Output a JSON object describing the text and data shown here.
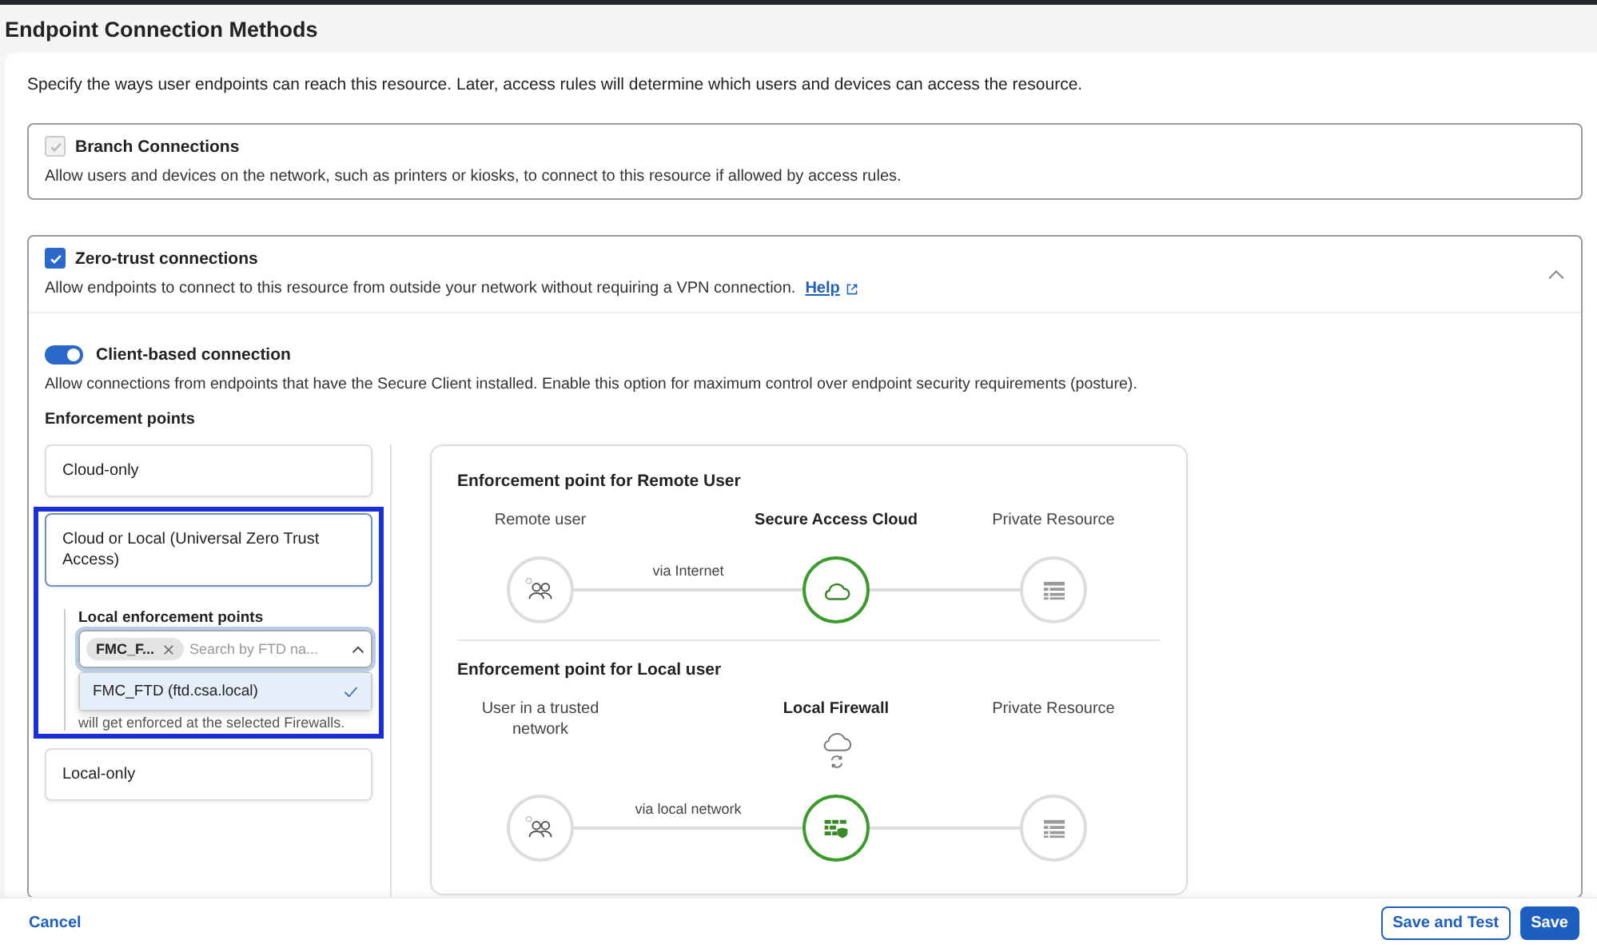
{
  "page_title": "Endpoint Connection Methods",
  "intro": "Specify the ways user endpoints can reach this resource. Later, access rules will determine which users and devices can access the resource.",
  "sections": [
    {
      "title": "Branch Connections",
      "description": "Allow users and devices on the network, such as printers or kiosks, to connect to this resource if allowed by access rules.",
      "checked": true,
      "disabled": true,
      "expanded": false
    },
    {
      "title": "Zero-trust connections",
      "description": "Allow endpoints to connect to this resource from outside your network without requiring a VPN connection.",
      "link": "Help",
      "checked": true,
      "disabled": false,
      "expanded": true
    }
  ],
  "client_connection": {
    "label": "Client-based connection",
    "on": true,
    "description": "Allow connections from endpoints that have the Secure Client installed. Enable this option for maximum control over endpoint security requirements (posture)."
  },
  "enforcement": {
    "heading": "Enforcement points",
    "options": [
      {
        "label": "Cloud-only",
        "selected": false
      },
      {
        "label": "Cloud or Local (Universal Zero Trust Access)",
        "selected": true
      },
      {
        "label": "Local-only",
        "selected": false
      }
    ],
    "local_points": {
      "label": "Local enforcement points",
      "tags": [
        "FMC_F..."
      ],
      "placeholder": "Search by FTD na...",
      "expanded": true,
      "options": [
        {
          "label": "FMC_FTD (ftd.csa.local)",
          "selected": true
        }
      ],
      "note": "will get enforced at the selected Firewalls."
    }
  },
  "diagram": [
    {
      "title": "Enforcement point for Remote User",
      "link_label": "via Internet",
      "nodes": [
        {
          "label": "Remote user",
          "kind": "user",
          "active": false
        },
        {
          "label": "Secure Access Cloud",
          "kind": "cloud",
          "active": true
        },
        {
          "label": "Private Resource",
          "kind": "resource",
          "active": false
        }
      ]
    },
    {
      "title": "Enforcement point for Local user",
      "link_label": "via local network",
      "nodes": [
        {
          "label": "User in a trusted network",
          "kind": "user",
          "active": false
        },
        {
          "label": "Local Firewall",
          "kind": "firewall",
          "active": true
        },
        {
          "label": "Private Resource",
          "kind": "resource",
          "active": false
        }
      ]
    }
  ],
  "footer": {
    "cancel": "Cancel",
    "buttons": [
      {
        "label": "Save and Test",
        "kind": "secondary"
      },
      {
        "label": "Save",
        "kind": "primary"
      }
    ]
  }
}
